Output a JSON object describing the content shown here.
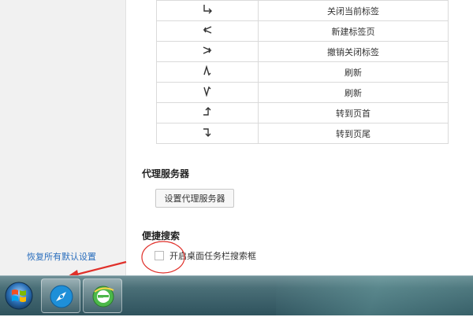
{
  "gesture_rows": [
    {
      "gesture_icon": "down-right-gesture-icon",
      "action": "关闭当前标签"
    },
    {
      "gesture_icon": "left-angle-gesture-icon",
      "action": "新建标签页"
    },
    {
      "gesture_icon": "right-angle-gesture-icon",
      "action": "撤销关闭标签"
    },
    {
      "gesture_icon": "up-down-gesture-icon",
      "action": "刷新"
    },
    {
      "gesture_icon": "down-up-gesture-icon",
      "action": "刷新"
    },
    {
      "gesture_icon": "right-up-gesture-icon",
      "action": "转到页首"
    },
    {
      "gesture_icon": "right-down-gesture-icon",
      "action": "转到页尾"
    }
  ],
  "proxy": {
    "title": "代理服务器",
    "button_label": "设置代理服务器"
  },
  "quick_search": {
    "title": "便捷搜索",
    "checkbox_label": "开启桌面任务栏搜索框",
    "checked": false
  },
  "restore_defaults_label": "恢复所有默认设置",
  "annotation_color": "#e0302a",
  "taskbar": {
    "items": [
      "start-orb-icon",
      "browser-icon",
      "ie-green-icon"
    ]
  }
}
